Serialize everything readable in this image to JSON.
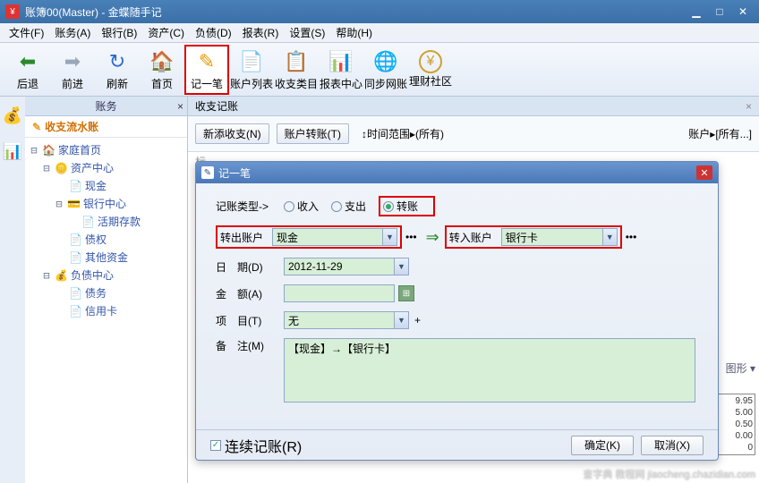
{
  "window": {
    "title": "账簿00(Master) - 金蝶随手记",
    "icon_text": "¥"
  },
  "menus": [
    "文件(F)",
    "账务(A)",
    "银行(B)",
    "资产(C)",
    "负债(D)",
    "报表(R)",
    "设置(S)",
    "帮助(H)"
  ],
  "toolbar": [
    {
      "label": "后退",
      "icon": "⬅",
      "color": "#2a8a2a"
    },
    {
      "label": "前进",
      "icon": "➡",
      "color": "#9aa7b8"
    },
    {
      "label": "刷新",
      "icon": "↻",
      "color": "#2a6acc"
    },
    {
      "label": "首页",
      "icon": "🏠",
      "color": "#e8a030"
    },
    {
      "label": "记一笔",
      "icon": "✎",
      "color": "#e89a00",
      "hl": true
    },
    {
      "label": "账户列表",
      "icon": "📄",
      "color": "#5a80c0"
    },
    {
      "label": "收支类目",
      "icon": "📋",
      "color": "#e8a030"
    },
    {
      "label": "报表中心",
      "icon": "📊",
      "color": "#4aa0d0"
    },
    {
      "label": "同步网账",
      "icon": "🌐",
      "color": "#2a80d0"
    },
    {
      "label": "理财社区",
      "icon": "¥",
      "color": "#d0a030"
    }
  ],
  "side_header": "账务",
  "tree_header": "收支流水账",
  "tree": {
    "home": "家庭首页",
    "assets": "资产中心",
    "cash": "现金",
    "bank": "银行中心",
    "demand": "活期存款",
    "bond": "债权",
    "other": "其他资金",
    "liab": "负债中心",
    "debt": "债务",
    "credit": "信用卡"
  },
  "tab": {
    "title": "收支记账"
  },
  "filter": {
    "new": "新添收支(N)",
    "transfer": "账户转账(T)",
    "range_label": "时间范围",
    "range_value": "(所有)",
    "acct_label": "账户",
    "acct_value": "[所有...]"
  },
  "bj_label": "标",
  "dialog": {
    "title": "记一笔",
    "type_label": "记账类型->",
    "type_income": "收入",
    "type_expense": "支出",
    "type_transfer": "转账",
    "from_label": "转出账户",
    "from_value": "现金",
    "to_label": "转入账户",
    "to_value": "银行卡",
    "date_label": "日　期(D)",
    "date_value": "2012-11-29",
    "amount_label": "金　额(A)",
    "amount_value": "",
    "project_label": "项　目(T)",
    "project_value": "无",
    "memo_label": "备　注(M)",
    "memo_value": "【现金】→【银行卡】",
    "continuous": "连续记账(R)",
    "ok": "确定(K)",
    "cancel": "取消(X)"
  },
  "rightnums": [
    "9.95",
    "5.00",
    "0.50",
    "0.00",
    "0"
  ],
  "bottomlabel": "图形",
  "watermark": "查字典 教程网  jiaocheng.chazidian.com"
}
